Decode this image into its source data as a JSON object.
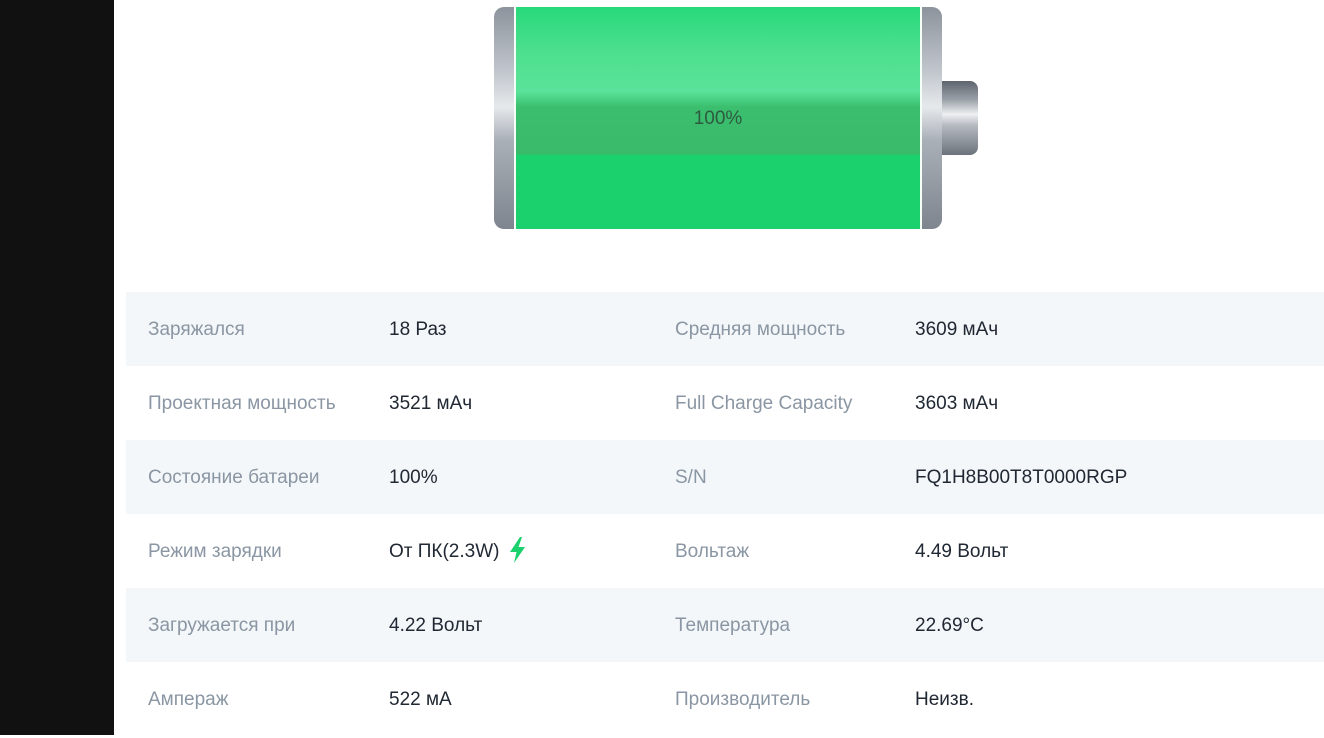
{
  "battery": {
    "level_percent": 100,
    "level_text": "100%",
    "fill_color": "#1ad16d"
  },
  "info_rows": [
    {
      "l1": "Заряжался",
      "v1": "18 Раз",
      "l2": "Средняя мощность",
      "v2": "3609 мАч"
    },
    {
      "l1": "Проектная мощность",
      "v1": "3521 мАч",
      "l2": "Full Charge Capacity",
      "v2": "3603 мАч"
    },
    {
      "l1": "Состояние батареи",
      "v1": "100%",
      "l2": "S/N",
      "v2": "FQ1H8B00T8T0000RGP"
    },
    {
      "l1": "Режим зарядки",
      "v1": "От ПК(2.3W)",
      "l2": "Вольтаж",
      "v2": "4.49 Вольт"
    },
    {
      "l1": "Загружается при",
      "v1": "4.22 Вольт",
      "l2": "Температура",
      "v2": "22.69°C"
    },
    {
      "l1": "Ампераж",
      "v1": "522 мА",
      "l2": "Производитель",
      "v2": "Неизв."
    }
  ],
  "icons": {
    "charging": "lightning-bolt-icon"
  },
  "colors": {
    "accent_green": "#1ad16d",
    "row_alt_bg": "#f4f7fa",
    "label_text": "#8a96a3",
    "value_text": "#202833",
    "sidebar_bg": "#111111"
  }
}
